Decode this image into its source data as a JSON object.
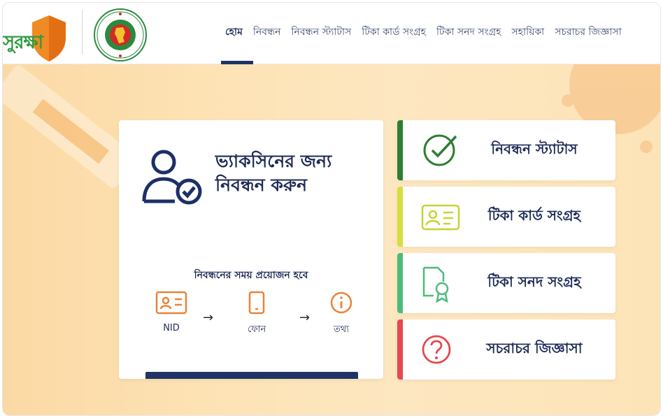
{
  "brand": {
    "name": "সুরক্ষা",
    "seal_ring_text": "গণপ্রজাতন্ত্রী বাংলাদেশ সরকার"
  },
  "nav": {
    "items": [
      {
        "label": "হোম",
        "active": true
      },
      {
        "label": "নিবন্ধন"
      },
      {
        "label": "নিবন্ধন স্ট্যাটাস"
      },
      {
        "label": "টিকা কার্ড সংগ্রহ"
      },
      {
        "label": "টিকা সনদ সংগ্রহ"
      },
      {
        "label": "সহায়িকা"
      },
      {
        "label": "সচরাচর জিজ্ঞাসা"
      }
    ]
  },
  "main_card": {
    "title": "ভ্যাকসিনের জন্য নিবন্ধন করুন",
    "requirements_title": "নিবন্ধনের সময় প্রয়োজন হবে",
    "requirements": [
      {
        "label": "NID",
        "icon": "id-card-icon"
      },
      {
        "label": "ফোন",
        "icon": "phone-icon"
      },
      {
        "label": "তথ্য",
        "icon": "info-icon"
      }
    ],
    "arrow": "→"
  },
  "side_cards": [
    {
      "label": "নিবন্ধন স্ট্যাটাস",
      "icon": "check-circle-icon",
      "accent": "#2e7d32"
    },
    {
      "label": "টিকা কার্ড সংগ্রহ",
      "icon": "vaccine-card-icon",
      "accent": "#d4df3a"
    },
    {
      "label": "টিকা সনদ সংগ্রহ",
      "icon": "certificate-icon",
      "accent": "#4cbb7a"
    },
    {
      "label": "সচরাচর জিজ্ঞাসা",
      "icon": "question-icon",
      "accent": "#e5484d"
    }
  ],
  "colors": {
    "navy": "#1d2a55",
    "brand_green": "#2e9a3e",
    "brand_orange": "#f08a24",
    "hero_bg": "#fde2b4",
    "icon_orange": "#e8833a"
  }
}
